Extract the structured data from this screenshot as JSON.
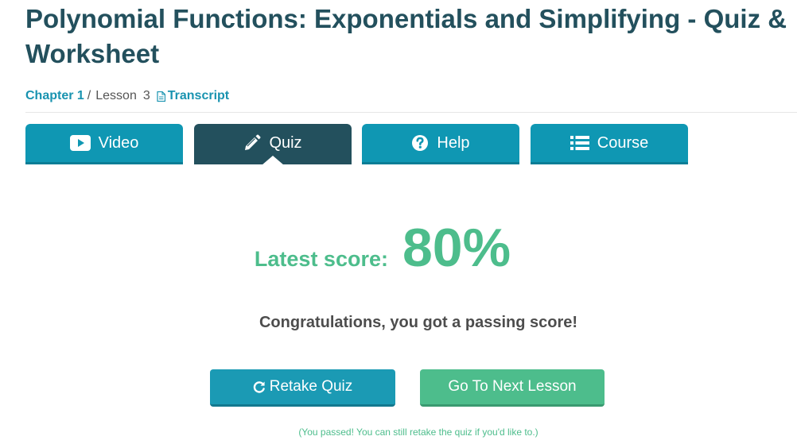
{
  "page": {
    "title": "Polynomial Functions: Exponentials and Simplifying - Quiz & Worksheet"
  },
  "breadcrumb": {
    "chapter": "Chapter 1",
    "separator": "/",
    "lesson_label": "Lesson",
    "lesson_number": "3",
    "transcript": "Transcript",
    "transcript_icon": "document-icon"
  },
  "tabs": [
    {
      "label": "Video",
      "icon": "play-icon",
      "active": false
    },
    {
      "label": "Quiz",
      "icon": "pencil-icon",
      "active": true
    },
    {
      "label": "Help",
      "icon": "question-icon",
      "active": false
    },
    {
      "label": "Course",
      "icon": "list-icon",
      "active": false
    }
  ],
  "result": {
    "score_label": "Latest score:",
    "score_value": "80%",
    "message": "Congratulations, you got a passing score!",
    "note": "(You passed! You can still retake the quiz if you'd like to.)"
  },
  "actions": {
    "retake_label": "Retake Quiz",
    "retake_icon": "refresh-icon",
    "next_label": "Go To Next Lesson"
  },
  "colors": {
    "title": "#23505d",
    "accent": "#0f97b3",
    "active_tab": "#23505d",
    "success": "#4dbd8c",
    "link": "#1993b0"
  }
}
